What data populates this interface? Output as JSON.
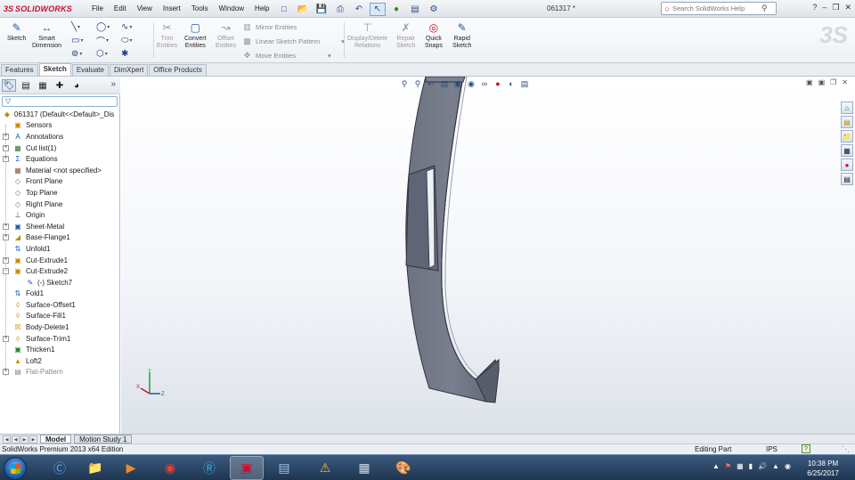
{
  "app": {
    "logo_ds": "3S",
    "logo_text": "SOLIDWORKS",
    "doc_title": "061317 *",
    "search_placeholder": "Search SolidWorks Help"
  },
  "menu": [
    "File",
    "Edit",
    "View",
    "Insert",
    "Tools",
    "Window",
    "Help"
  ],
  "command_manager": {
    "sketch": "Sketch",
    "smart_dimension": "Smart\nDimension",
    "trim": "Trim\nEntities",
    "convert": "Convert\nEntities",
    "offset": "Offset\nEntities",
    "mirror": "Mirror Entities",
    "linear_pattern": "Linear Sketch Pattern",
    "move": "Move Entities",
    "display_delete": "Display/Delete\nRelations",
    "repair": "Repair\nSketch",
    "quick_snaps": "Quick\nSnaps",
    "rapid_sketch": "Rapid\nSketch"
  },
  "tabs": [
    "Features",
    "Sketch",
    "Evaluate",
    "DimXpert",
    "Office Products"
  ],
  "active_tab": "Sketch",
  "tree": {
    "root": "061317  (Default<<Default>_Dis",
    "items": [
      {
        "label": "Sensors",
        "icon": "sensor-icon",
        "expand": false
      },
      {
        "label": "Annotations",
        "icon": "annotations-icon",
        "expand": true
      },
      {
        "label": "Cut list(1)",
        "icon": "cut-list-icon",
        "expand": true
      },
      {
        "label": "Equations",
        "icon": "equations-icon",
        "expand": true
      },
      {
        "label": "Material <not specified>",
        "icon": "material-icon",
        "expand": false
      },
      {
        "label": "Front Plane",
        "icon": "plane-icon",
        "expand": false
      },
      {
        "label": "Top Plane",
        "icon": "plane-icon",
        "expand": false
      },
      {
        "label": "Right Plane",
        "icon": "plane-icon",
        "expand": false
      },
      {
        "label": "Origin",
        "icon": "origin-icon",
        "expand": false
      },
      {
        "label": "Sheet-Metal",
        "icon": "sheet-metal-icon",
        "expand": true
      },
      {
        "label": "Base-Flange1",
        "icon": "base-flange-icon",
        "expand": true
      },
      {
        "label": "Unfold1",
        "icon": "unfold-icon",
        "expand": false
      },
      {
        "label": "Cut-Extrude1",
        "icon": "cut-extrude-icon",
        "expand": true
      },
      {
        "label": "Cut-Extrude2",
        "icon": "cut-extrude-icon",
        "expand": true,
        "open": true
      },
      {
        "label": "(-) Sketch7",
        "icon": "sketch-icon",
        "child": true
      },
      {
        "label": "Fold1",
        "icon": "fold-icon",
        "expand": false
      },
      {
        "label": "Surface-Offset1",
        "icon": "surface-offset-icon",
        "expand": false
      },
      {
        "label": "Surface-Fill1",
        "icon": "surface-fill-icon",
        "expand": false
      },
      {
        "label": "Body-Delete1",
        "icon": "body-delete-icon",
        "expand": false
      },
      {
        "label": "Surface-Trim1",
        "icon": "surface-trim-icon",
        "expand": true
      },
      {
        "label": "Thicken1",
        "icon": "thicken-icon",
        "expand": false
      },
      {
        "label": "Loft2",
        "icon": "loft-icon",
        "expand": false
      },
      {
        "label": "Flat-Pattern",
        "icon": "flat-pattern-icon",
        "expand": true,
        "greyed": true
      }
    ]
  },
  "bottom_tabs": [
    "Model",
    "Motion Study 1"
  ],
  "status": {
    "edition": "SolidWorks Premium 2013 x64 Edition",
    "mode": "Editing Part",
    "units": "IPS"
  },
  "clock": {
    "time": "10:38 PM",
    "date": "6/25/2017"
  },
  "triad": {
    "x": "X",
    "y": "Y",
    "z": "Z"
  },
  "colors": {
    "brand": "#c8102e",
    "part": "#6e7382",
    "part_edge": "#2f3240",
    "viewport_bottom": "#dde2ea"
  }
}
